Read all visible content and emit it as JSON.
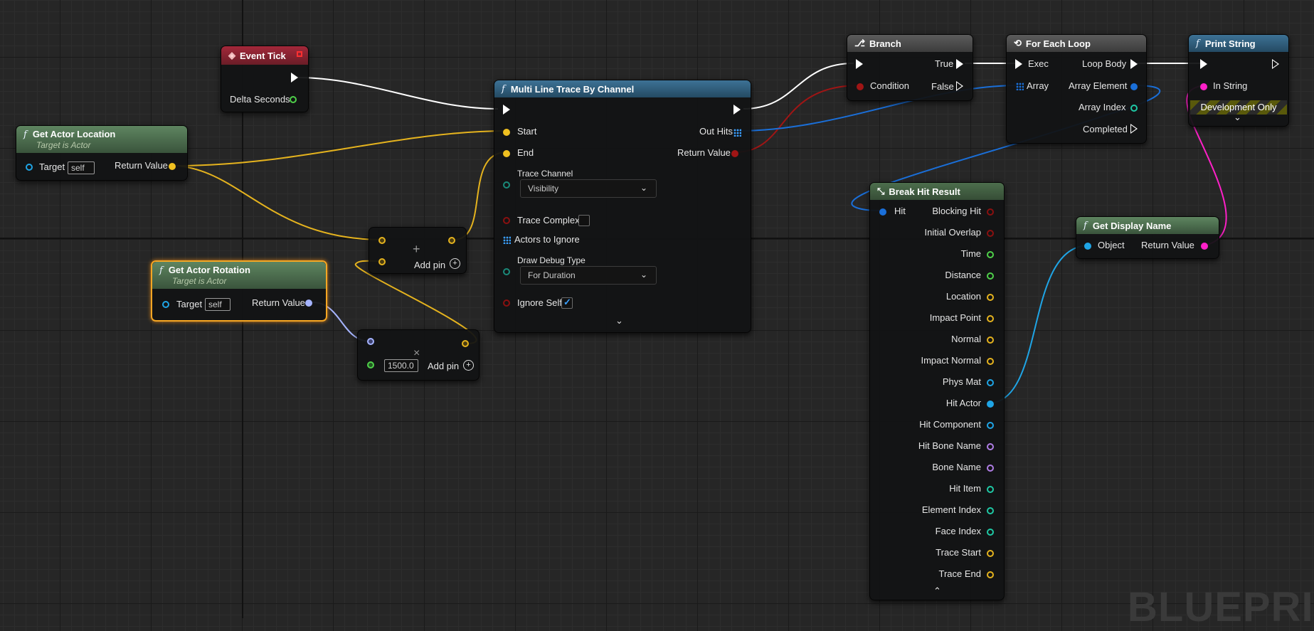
{
  "canvas": {
    "watermark": "BLUEPRINT"
  },
  "nodes": {
    "event_tick": {
      "title": "Event Tick",
      "delta_seconds": "Delta Seconds"
    },
    "get_actor_location": {
      "title": "Get Actor Location",
      "subtitle": "Target is Actor",
      "target": "Target",
      "target_value": "self",
      "return_value": "Return Value"
    },
    "get_actor_rotation": {
      "title": "Get Actor Rotation",
      "subtitle": "Target is Actor",
      "target": "Target",
      "target_value": "self",
      "return_value": "Return Value"
    },
    "add_node": {
      "icon": "+",
      "add_pin": "Add pin"
    },
    "multiply_node": {
      "icon": "×",
      "value": "1500.0",
      "add_pin": "Add pin"
    },
    "multi_line_trace": {
      "title": "Multi Line Trace By Channel",
      "start": "Start",
      "end": "End",
      "trace_channel": "Trace Channel",
      "trace_channel_value": "Visibility",
      "trace_complex": "Trace Complex",
      "trace_complex_checked": false,
      "actors_to_ignore": "Actors to Ignore",
      "draw_debug_type": "Draw Debug Type",
      "draw_debug_type_value": "For Duration",
      "ignore_self": "Ignore Self",
      "ignore_self_checked": true,
      "out_hits": "Out Hits",
      "return_value": "Return Value"
    },
    "branch": {
      "title": "Branch",
      "condition": "Condition",
      "true": "True",
      "false": "False"
    },
    "for_each_loop": {
      "title": "For Each Loop",
      "exec": "Exec",
      "array": "Array",
      "loop_body": "Loop Body",
      "array_element": "Array Element",
      "array_index": "Array Index",
      "completed": "Completed"
    },
    "print_string": {
      "title": "Print String",
      "in_string": "In String",
      "development_only": "Development Only"
    },
    "break_hit_result": {
      "title": "Break Hit Result",
      "hit": "Hit",
      "outputs": [
        {
          "label": "Blocking Hit",
          "color": "#8a1010"
        },
        {
          "label": "Initial Overlap",
          "color": "#8a1010"
        },
        {
          "label": "Time",
          "color": "#4fd14a"
        },
        {
          "label": "Distance",
          "color": "#4fd14a"
        },
        {
          "label": "Location",
          "color": "#e5b31e"
        },
        {
          "label": "Impact Point",
          "color": "#e5b31e"
        },
        {
          "label": "Normal",
          "color": "#e5b31e"
        },
        {
          "label": "Impact Normal",
          "color": "#e5b31e"
        },
        {
          "label": "Phys Mat",
          "color": "#1fa5e6"
        },
        {
          "label": "Hit Actor",
          "color": "#1fa5e6"
        },
        {
          "label": "Hit Component",
          "color": "#1fa5e6"
        },
        {
          "label": "Hit Bone Name",
          "color": "#b07ee6"
        },
        {
          "label": "Bone Name",
          "color": "#b07ee6"
        },
        {
          "label": "Hit Item",
          "color": "#1fc9a5"
        },
        {
          "label": "Element Index",
          "color": "#1fc9a5"
        },
        {
          "label": "Face Index",
          "color": "#1fc9a5"
        },
        {
          "label": "Trace Start",
          "color": "#e5b31e"
        },
        {
          "label": "Trace End",
          "color": "#e5b31e"
        }
      ]
    },
    "get_display_name": {
      "title": "Get Display Name",
      "object": "Object",
      "return_value": "Return Value"
    }
  },
  "pin_colors": {
    "exec": "#ffffff",
    "vector": "#f0c020",
    "rotator": "#a5b4ff",
    "bool": "#a01515",
    "float": "#4fd14a",
    "object": "#1fa5e6",
    "string": "#ff20c8",
    "struct_array": "#1a6fd9",
    "int": "#1fc9a5"
  }
}
